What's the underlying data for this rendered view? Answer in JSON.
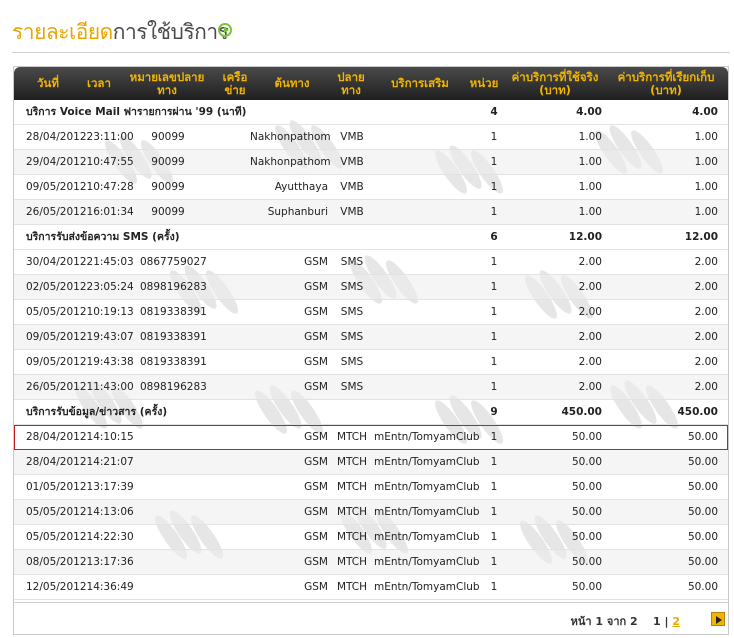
{
  "header": {
    "title_part1": "รายละเอียด",
    "title_part2": "การใช้บริการ",
    "icon": "go-arrow-icon"
  },
  "colors": {
    "accent": "#f2b400",
    "header_bg": "#2a2a2a",
    "selected_outline": "#c81e1e",
    "title_dark": "#4a4a4a"
  },
  "table": {
    "columns": [
      {
        "key": "date",
        "label": "วันที่"
      },
      {
        "key": "time",
        "label": "เวลา"
      },
      {
        "key": "number",
        "label": "หมายเลขปลายทาง"
      },
      {
        "key": "network",
        "label": "เครือข่าย"
      },
      {
        "key": "origin",
        "label": "ต้นทาง"
      },
      {
        "key": "dest",
        "label": "ปลายทาง"
      },
      {
        "key": "service",
        "label": "บริการเสริม"
      },
      {
        "key": "units",
        "label": "หน่วย"
      },
      {
        "key": "actual",
        "label": "ค่าบริการที่ใช้จริง (บาท)"
      },
      {
        "key": "charged",
        "label": "ค่าบริการที่เรียกเก็บ (บาท)"
      }
    ],
    "rows": [
      {
        "type": "group",
        "title": "บริการ Voice Mail ฟารายการผ่าน '99 (นาที)",
        "units": "4",
        "actual": "4.00",
        "charged": "4.00"
      },
      {
        "type": "data",
        "datetime": "28/04/201223:11:00",
        "number": "90099",
        "origin": "Nakhonpathom",
        "dest": "VMB",
        "service": "",
        "units": "1",
        "actual": "1.00",
        "charged": "1.00"
      },
      {
        "type": "data",
        "datetime": "29/04/201210:47:55",
        "number": "90099",
        "origin": "Nakhonpathom",
        "dest": "VMB",
        "service": "",
        "units": "1",
        "actual": "1.00",
        "charged": "1.00"
      },
      {
        "type": "data",
        "datetime": "09/05/201210:47:28",
        "number": "90099",
        "origin": "Ayutthaya",
        "dest": "VMB",
        "service": "",
        "units": "1",
        "actual": "1.00",
        "charged": "1.00"
      },
      {
        "type": "data",
        "datetime": "26/05/201216:01:34",
        "number": "90099",
        "origin": "Suphanburi",
        "dest": "VMB",
        "service": "",
        "units": "1",
        "actual": "1.00",
        "charged": "1.00"
      },
      {
        "type": "group",
        "title": "บริการรับส่งข้อความ SMS (ครั้ง)",
        "units": "6",
        "actual": "12.00",
        "charged": "12.00"
      },
      {
        "type": "data",
        "datetime": "30/04/201221:45:03",
        "number": "0867759027",
        "origin": "GSM",
        "dest": "SMS",
        "service": "",
        "units": "1",
        "actual": "2.00",
        "charged": "2.00"
      },
      {
        "type": "data",
        "datetime": "02/05/201223:05:24",
        "number": "0898196283",
        "origin": "GSM",
        "dest": "SMS",
        "service": "",
        "units": "1",
        "actual": "2.00",
        "charged": "2.00"
      },
      {
        "type": "data",
        "datetime": "05/05/201210:19:13",
        "number": "0819338391",
        "origin": "GSM",
        "dest": "SMS",
        "service": "",
        "units": "1",
        "actual": "2.00",
        "charged": "2.00"
      },
      {
        "type": "data",
        "datetime": "09/05/201219:43:07",
        "number": "0819338391",
        "origin": "GSM",
        "dest": "SMS",
        "service": "",
        "units": "1",
        "actual": "2.00",
        "charged": "2.00"
      },
      {
        "type": "data",
        "datetime": "09/05/201219:43:38",
        "number": "0819338391",
        "origin": "GSM",
        "dest": "SMS",
        "service": "",
        "units": "1",
        "actual": "2.00",
        "charged": "2.00"
      },
      {
        "type": "data",
        "datetime": "26/05/201211:43:00",
        "number": "0898196283",
        "origin": "GSM",
        "dest": "SMS",
        "service": "",
        "units": "1",
        "actual": "2.00",
        "charged": "2.00"
      },
      {
        "type": "group",
        "title": "บริการรับข้อมูล/ข่าวสาร (ครั้ง)",
        "units": "9",
        "actual": "450.00",
        "charged": "450.00"
      },
      {
        "type": "data",
        "selected": true,
        "datetime": "28/04/201214:10:15",
        "number": "",
        "origin": "GSM",
        "dest": "MTCH",
        "service": "mEntn/TomyamClub",
        "units": "1",
        "actual": "50.00",
        "charged": "50.00"
      },
      {
        "type": "data",
        "datetime": "28/04/201214:21:07",
        "number": "",
        "origin": "GSM",
        "dest": "MTCH",
        "service": "mEntn/TomyamClub",
        "units": "1",
        "actual": "50.00",
        "charged": "50.00"
      },
      {
        "type": "data",
        "datetime": "01/05/201213:17:39",
        "number": "",
        "origin": "GSM",
        "dest": "MTCH",
        "service": "mEntn/TomyamClub",
        "units": "1",
        "actual": "50.00",
        "charged": "50.00"
      },
      {
        "type": "data",
        "datetime": "05/05/201214:13:06",
        "number": "",
        "origin": "GSM",
        "dest": "MTCH",
        "service": "mEntn/TomyamClub",
        "units": "1",
        "actual": "50.00",
        "charged": "50.00"
      },
      {
        "type": "data",
        "datetime": "05/05/201214:22:30",
        "number": "",
        "origin": "GSM",
        "dest": "MTCH",
        "service": "mEntn/TomyamClub",
        "units": "1",
        "actual": "50.00",
        "charged": "50.00"
      },
      {
        "type": "data",
        "datetime": "08/05/201213:17:36",
        "number": "",
        "origin": "GSM",
        "dest": "MTCH",
        "service": "mEntn/TomyamClub",
        "units": "1",
        "actual": "50.00",
        "charged": "50.00"
      },
      {
        "type": "data",
        "datetime": "12/05/201214:36:49",
        "number": "",
        "origin": "GSM",
        "dest": "MTCH",
        "service": "mEntn/TomyamClub",
        "units": "1",
        "actual": "50.00",
        "charged": "50.00"
      }
    ]
  },
  "pager": {
    "label": "หน้า 1 จาก 2",
    "current": "1",
    "separator": "|",
    "next_page": "2",
    "next_icon": "next-arrow-icon"
  }
}
